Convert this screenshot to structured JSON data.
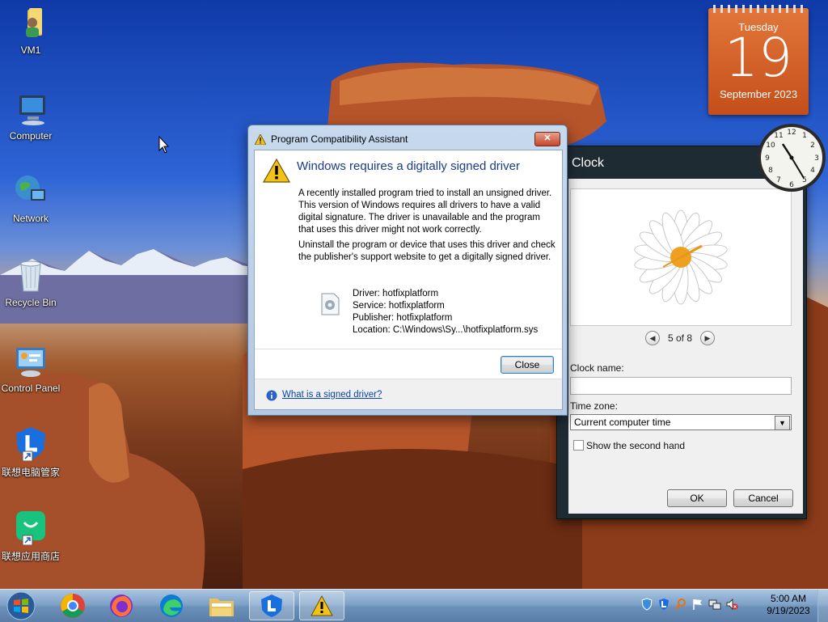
{
  "desktop_icons": [
    {
      "label": "VM1"
    },
    {
      "label": "Computer"
    },
    {
      "label": "Network"
    },
    {
      "label": "Recycle Bin"
    },
    {
      "label": "Control Panel"
    },
    {
      "label": "联想电脑管家"
    },
    {
      "label": "联想应用商店"
    }
  ],
  "calendar": {
    "weekday": "Tuesday",
    "day": "19",
    "month_year": "September 2023"
  },
  "clock_window": {
    "title": "Clock",
    "pager": "5 of 8",
    "clock_name_label": "Clock name:",
    "clock_name_value": "",
    "time_zone_label": "Time zone:",
    "time_zone_value": "Current computer time",
    "second_hand_label": "Show the second hand",
    "ok_label": "OK",
    "cancel_label": "Cancel"
  },
  "dialog": {
    "title": "Program Compatibility Assistant",
    "close_x": "✕",
    "heading": "Windows requires a digitally signed driver",
    "paragraph1": "A recently installed program tried to install an unsigned driver. This version of Windows requires all drivers to have a valid digital signature. The driver is unavailable and the program that uses this driver might not work correctly.",
    "paragraph2": "Uninstall the program or device that uses this driver and check the publisher's support website to get a digitally signed driver.",
    "driver": "Driver: hotfixplatform",
    "service": "Service: hotfixplatform",
    "publisher": "Publisher: hotfixplatform",
    "location": "Location: C:\\Windows\\Sy...\\hotfixplatform.sys",
    "close_button": "Close",
    "help_link": "What is a signed driver?"
  },
  "taskbar": {
    "time": "5:00 AM",
    "date": "9/19/2023"
  },
  "colors": {
    "accent_orange": "#d4602a",
    "heading_blue": "#1a3b8a",
    "link_blue": "#0645ad"
  }
}
